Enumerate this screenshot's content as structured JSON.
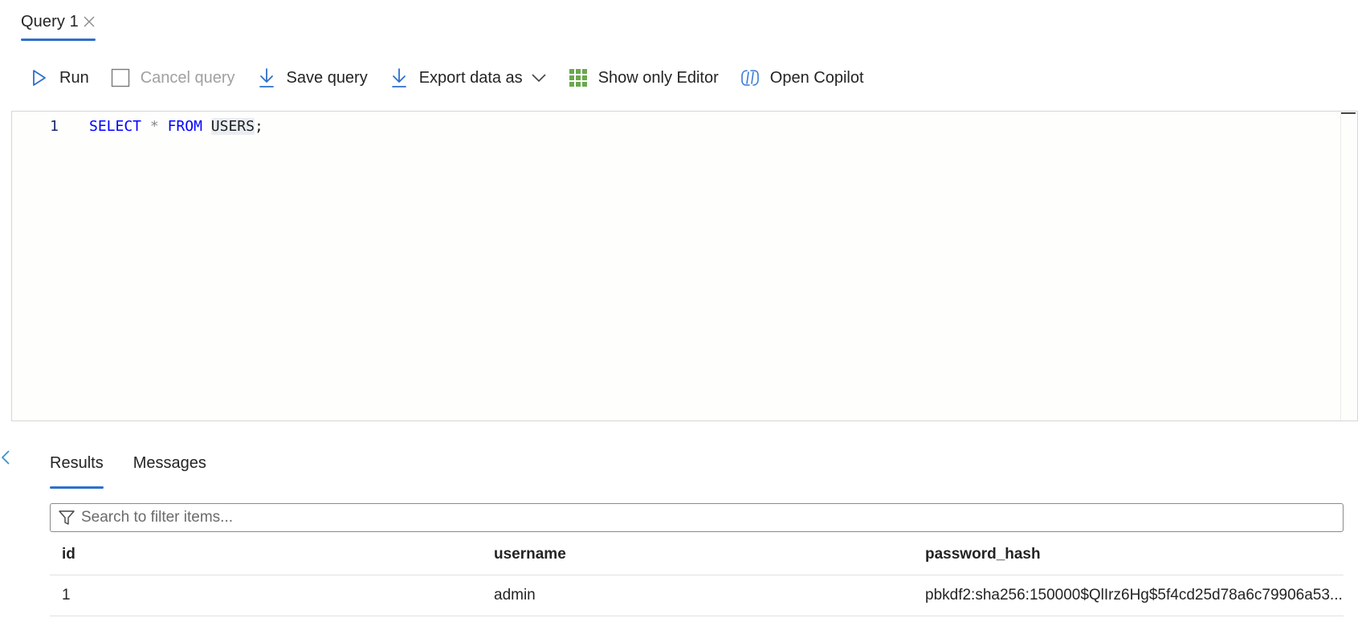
{
  "tab": {
    "title": "Query 1"
  },
  "toolbar": {
    "run": "Run",
    "cancel": "Cancel query",
    "save": "Save query",
    "export": "Export data as",
    "show_editor": "Show only Editor",
    "copilot": "Open Copilot"
  },
  "editor": {
    "line_number": "1",
    "tokens": {
      "select": "SELECT",
      "star": "*",
      "from": "FROM",
      "table": "USERS",
      "semicolon": ";"
    }
  },
  "results": {
    "tabs": [
      "Results",
      "Messages"
    ],
    "active_tab": "Results",
    "search_placeholder": "Search to filter items...",
    "columns": [
      "id",
      "username",
      "password_hash"
    ],
    "rows": [
      [
        "1",
        "admin",
        "pbkdf2:sha256:150000$QlIrz6Hg$5f4cd25d78a6c79906a53..."
      ]
    ]
  },
  "colors": {
    "accent": "#2f6fcd",
    "keyword": "#0000ff",
    "grid_icon": "#6aa84f"
  },
  "icons": {
    "run": "play-icon",
    "cancel": "checkbox-icon",
    "save": "download-icon",
    "export": "download-icon",
    "show_editor": "grid-icon",
    "copilot": "copilot-icon",
    "filter": "filter-icon"
  }
}
